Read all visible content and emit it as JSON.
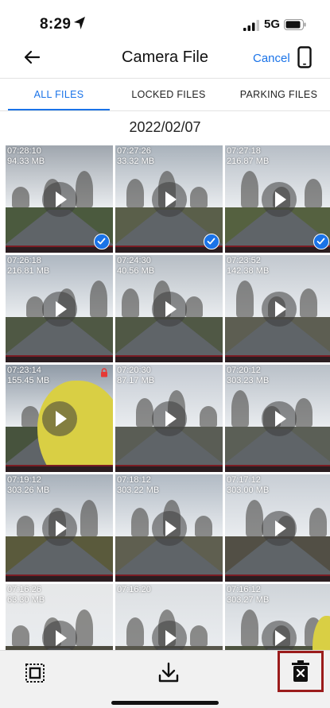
{
  "status_bar": {
    "time": "8:29",
    "network": "5G"
  },
  "header": {
    "title": "Camera File",
    "cancel_label": "Cancel"
  },
  "tabs": [
    {
      "label": "ALL FILES",
      "active": true
    },
    {
      "label": "LOCKED FILES",
      "active": false
    },
    {
      "label": "PARKING FILES",
      "active": false
    }
  ],
  "date_heading": "2022/02/07",
  "files": [
    {
      "time": "07:28:10",
      "size": "94.33 MB",
      "selected": true,
      "locked": false
    },
    {
      "time": "07:27:26",
      "size": "33.32 MB",
      "selected": true,
      "locked": false
    },
    {
      "time": "07:27:18",
      "size": "216.87 MB",
      "selected": true,
      "locked": false
    },
    {
      "time": "07:26:18",
      "size": "216.81 MB",
      "selected": false,
      "locked": false
    },
    {
      "time": "07:24:30",
      "size": "40.56 MB",
      "selected": false,
      "locked": false
    },
    {
      "time": "07:23:52",
      "size": "142.38 MB",
      "selected": false,
      "locked": false
    },
    {
      "time": "07:23:14",
      "size": "155.45 MB",
      "selected": false,
      "locked": true
    },
    {
      "time": "07:20:30",
      "size": "87.17 MB",
      "selected": false,
      "locked": false
    },
    {
      "time": "07:20:12",
      "size": "303.23 MB",
      "selected": false,
      "locked": false
    },
    {
      "time": "07:19:12",
      "size": "303.26 MB",
      "selected": false,
      "locked": false
    },
    {
      "time": "07:18:12",
      "size": "303.22 MB",
      "selected": false,
      "locked": false
    },
    {
      "time": "07:17:12",
      "size": "303.00 MB",
      "selected": false,
      "locked": false
    },
    {
      "time": "07:16:26",
      "size": "63.30 MB",
      "selected": false,
      "locked": false
    },
    {
      "time": "07:16:20",
      "size": "",
      "selected": false,
      "locked": false
    },
    {
      "time": "07:16:12",
      "size": "303.27 MB",
      "selected": false,
      "locked": false
    }
  ],
  "toolbar": {
    "items": [
      {
        "icon": "select-all-icon"
      },
      {
        "icon": "download-icon"
      },
      {
        "icon": "delete-icon"
      }
    ]
  },
  "colors": {
    "accent": "#1a73e8",
    "delete_highlight": "#9b1c1c",
    "lock": "#e53935"
  }
}
